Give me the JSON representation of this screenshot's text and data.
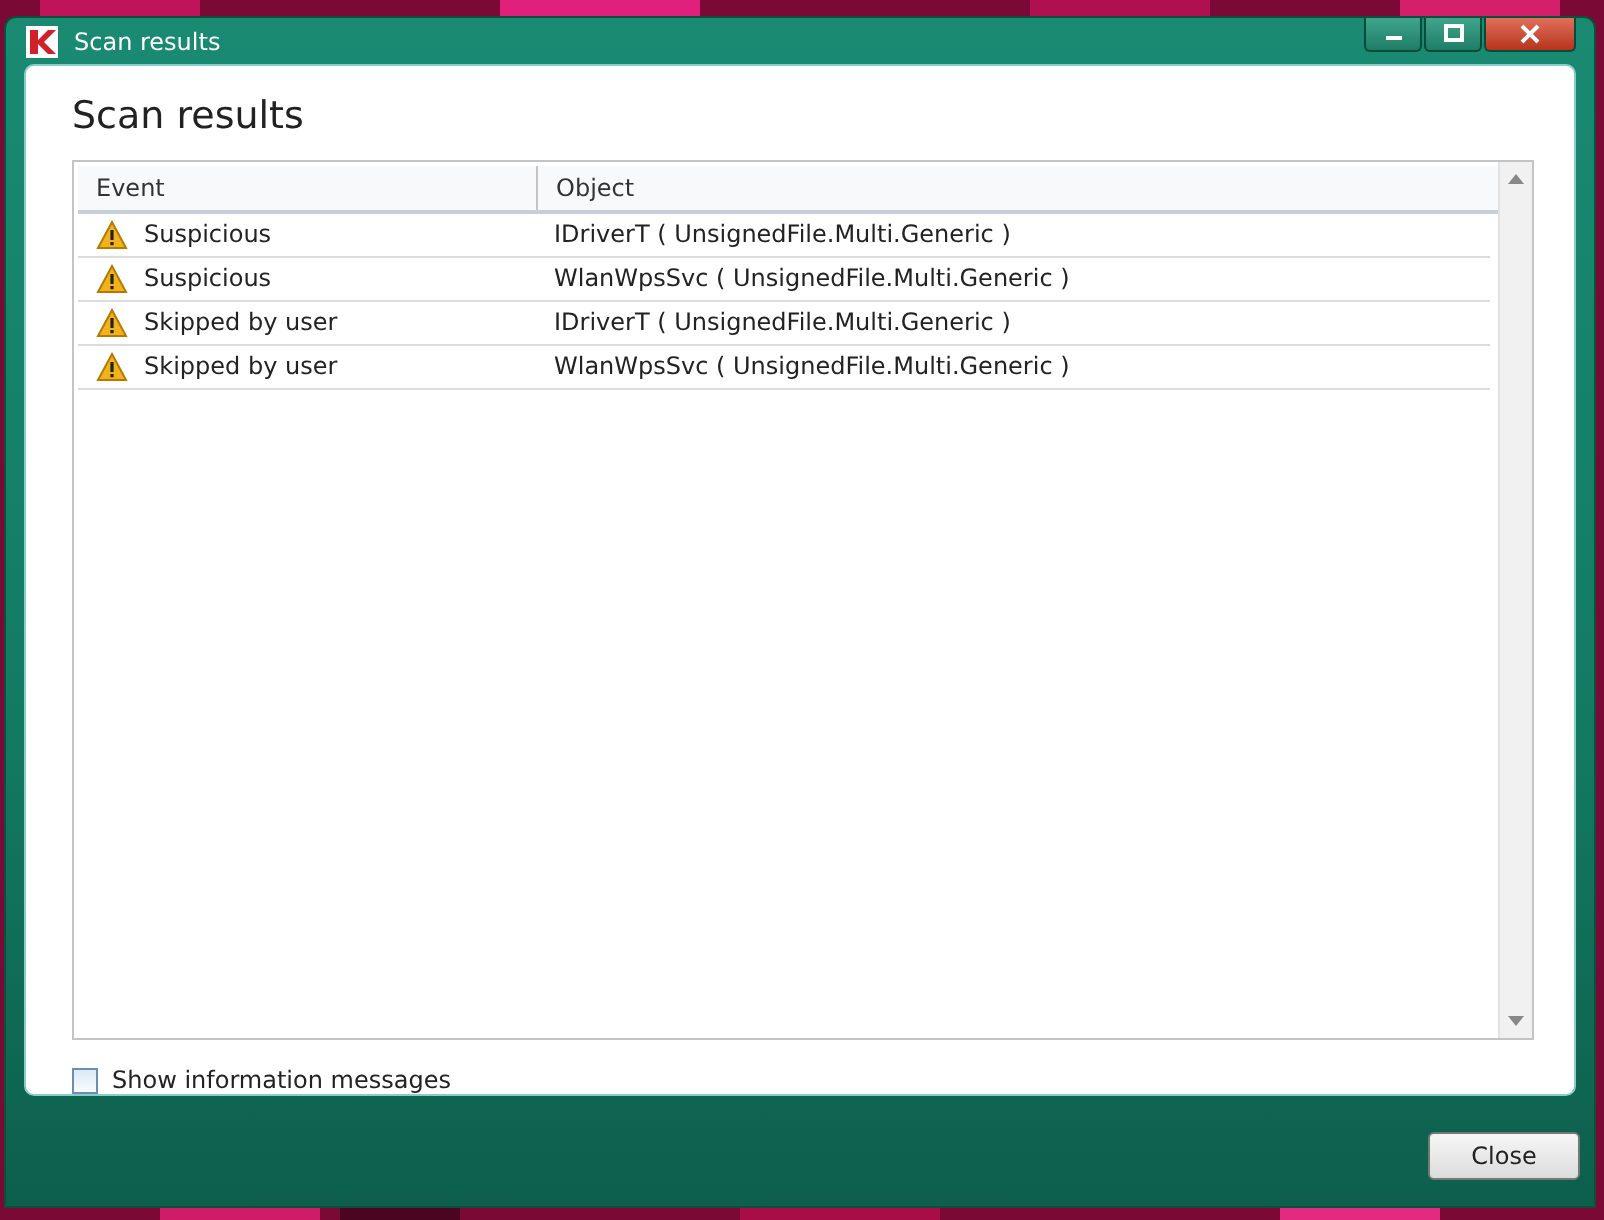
{
  "window": {
    "title": "Scan results"
  },
  "heading": "Scan results",
  "table": {
    "columns": [
      "Event",
      "Object"
    ],
    "rows": [
      {
        "event": "Suspicious",
        "object": "IDriverT ( UnsignedFile.Multi.Generic )"
      },
      {
        "event": "Suspicious",
        "object": "WlanWpsSvc ( UnsignedFile.Multi.Generic )"
      },
      {
        "event": "Skipped by user",
        "object": "IDriverT ( UnsignedFile.Multi.Generic )"
      },
      {
        "event": "Skipped by user",
        "object": "WlanWpsSvc ( UnsignedFile.Multi.Generic )"
      }
    ]
  },
  "show_info": {
    "label": "Show information messages",
    "checked": false
  },
  "buttons": [
    "Close"
  ]
}
